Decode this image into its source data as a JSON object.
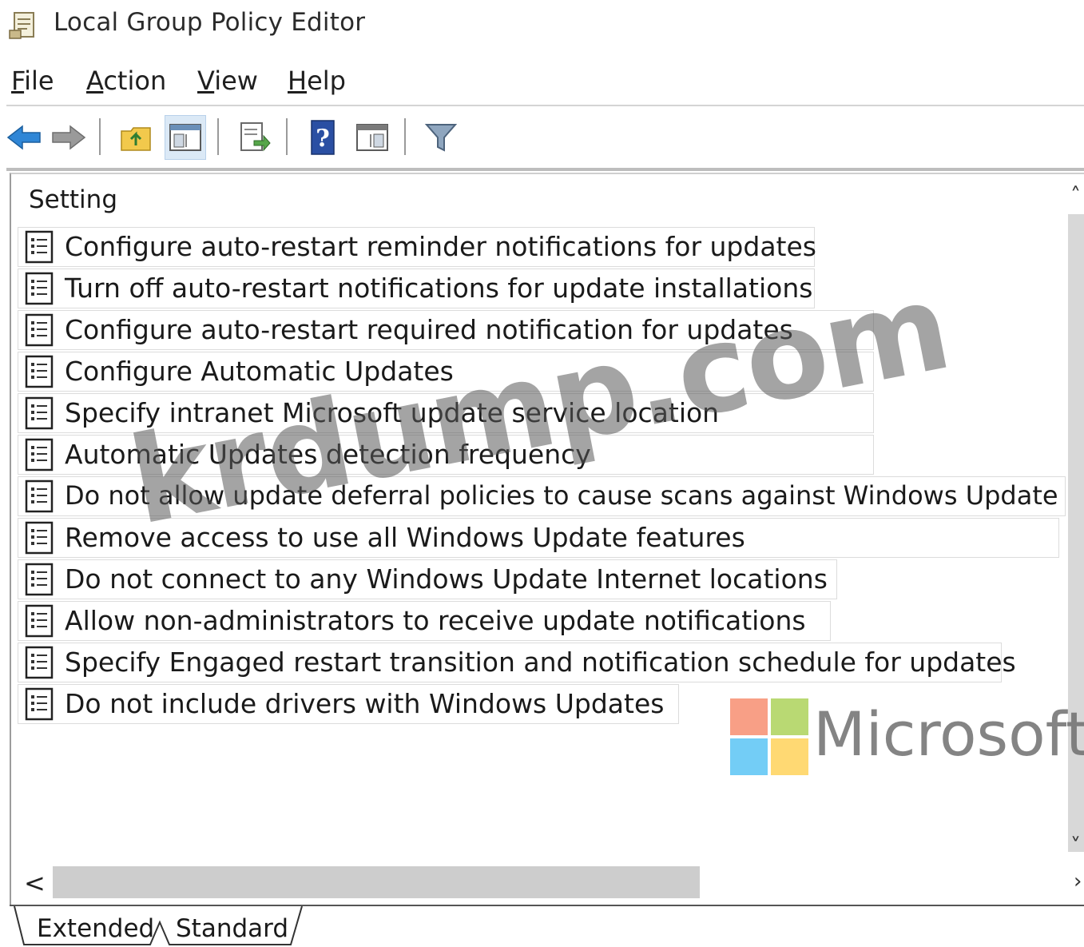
{
  "window": {
    "title": "Local Group Policy Editor"
  },
  "menu": {
    "file": {
      "accel": "F",
      "rest": "ile"
    },
    "action": {
      "accel": "A",
      "rest": "ction"
    },
    "view": {
      "accel": "V",
      "rest": "iew"
    },
    "help": {
      "accel": "H",
      "rest": "elp"
    }
  },
  "toolbar": {
    "buttons": [
      "back-icon",
      "forward-icon",
      "up-folder-icon",
      "show-hide-console-tree-icon",
      "export-list-icon",
      "help-icon",
      "show-hide-action-pane-icon",
      "filter-icon"
    ]
  },
  "list": {
    "column_header": "Setting",
    "rows": [
      "Configure auto-restart reminder notifications for updates",
      "Turn off auto-restart notifications for update installations",
      "Configure auto-restart required notification for updates",
      "Configure Automatic Updates",
      "Specify intranet Microsoft update service location",
      "Automatic Updates detection frequency",
      "Do not allow update deferral policies to cause scans against Windows Update",
      "Remove access to use all Windows Update features",
      "Do not connect to any Windows Update Internet locations",
      "Allow non-administrators to receive update notifications",
      "Specify Engaged restart transition and notification schedule for updates",
      "Do not include drivers with Windows Updates"
    ]
  },
  "scrollbar": {
    "left_arrow": "<"
  },
  "tabs": {
    "extended": "Extended",
    "standard": "Standard"
  },
  "overlay": {
    "watermark": "krdump.com",
    "brand": "Microsoft",
    "logo_colors": [
      "#f25022",
      "#7fba00",
      "#00a4ef",
      "#ffb900"
    ]
  }
}
